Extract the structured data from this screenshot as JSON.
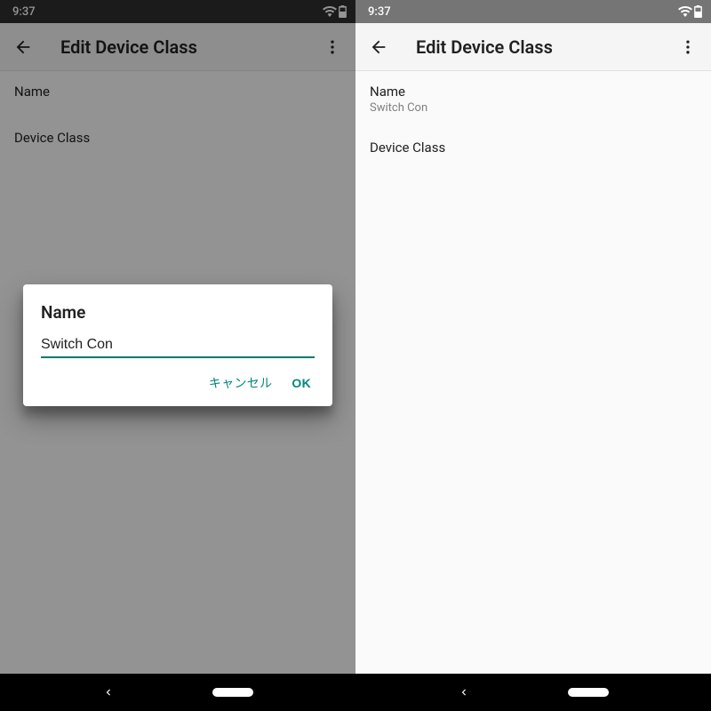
{
  "status": {
    "time": "9:37"
  },
  "appbar": {
    "title": "Edit Device Class"
  },
  "left": {
    "fields": {
      "name_label": "Name",
      "device_class_label": "Device Class"
    },
    "dialog": {
      "title": "Name",
      "value": "Switch Con",
      "cancel": "キャンセル",
      "ok": "OK"
    }
  },
  "right": {
    "fields": {
      "name_label": "Name",
      "name_value": "Switch Con",
      "device_class_label": "Device Class"
    }
  },
  "colors": {
    "accent": "#00796b"
  }
}
